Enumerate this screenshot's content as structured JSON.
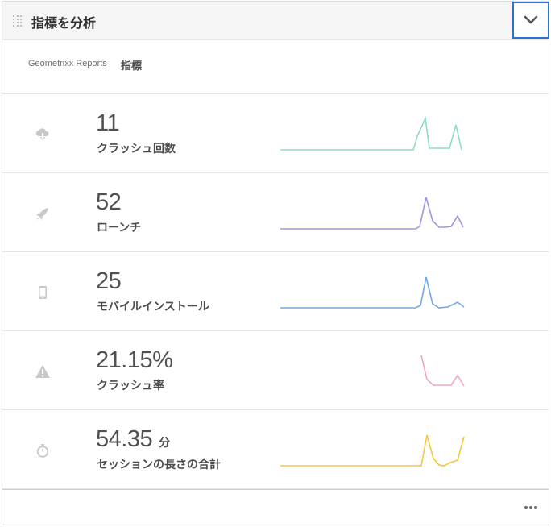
{
  "header": {
    "title": "指標を分析",
    "toggle_icon": "chevron-down-icon"
  },
  "subtitle": {
    "brand": "Geometrixx Reports",
    "label": "指標"
  },
  "colors": {
    "crashes": "#8ddbc9",
    "launches": "#a892e0",
    "installs": "#6ea8ee",
    "crash_rate": "#f1a3c1",
    "session": "#f3c93b",
    "accent": "#2f6fd6"
  },
  "metrics": [
    {
      "value": "11",
      "unit": "",
      "label": "クラッシュ回数",
      "icon": "cloud-download-icon"
    },
    {
      "value": "52",
      "unit": "",
      "label": "ローンチ",
      "icon": "rocket-icon"
    },
    {
      "value": "25",
      "unit": "",
      "label": "モバイルインストール",
      "icon": "mobile-device-icon"
    },
    {
      "value": "21.15%",
      "unit": "",
      "label": "クラッシュ率",
      "icon": "alert-icon"
    },
    {
      "value": "54.35",
      "unit": "分",
      "label": "セッションの長さの合計",
      "icon": "stopwatch-icon"
    }
  ],
  "sparklines": [
    {
      "metric": "crashes",
      "values": [
        0,
        0,
        0,
        0,
        0,
        0,
        0,
        0,
        0,
        0,
        0,
        0,
        0,
        0,
        0,
        0,
        0,
        0,
        0,
        0,
        0,
        0,
        0,
        0,
        0,
        0,
        0,
        0,
        0,
        0,
        0,
        0,
        0,
        0,
        0,
        0,
        0,
        0,
        0,
        0,
        0,
        0,
        0,
        0,
        0,
        0,
        0,
        0,
        0,
        0,
        0,
        0,
        0,
        0,
        0,
        0,
        0,
        0,
        0,
        0,
        0,
        0,
        0,
        0,
        0,
        0,
        0,
        0,
        0,
        0,
        0,
        0,
        0,
        0,
        0,
        0,
        0,
        0,
        0,
        0,
        0,
        0,
        0,
        0,
        0,
        0,
        0,
        0,
        0,
        0,
        0,
        0,
        0,
        0,
        0,
        0,
        0,
        0,
        0,
        0,
        0,
        0,
        0,
        0,
        0,
        0,
        0,
        0,
        0,
        0,
        0,
        0,
        0,
        0,
        0,
        0,
        0,
        0,
        0,
        0,
        0,
        0,
        0,
        0,
        0,
        0,
        0,
        0,
        0,
        0,
        0,
        0,
        0,
        0,
        0,
        0,
        0,
        0,
        0,
        0,
        0,
        0,
        0,
        0,
        0,
        0,
        0,
        0,
        0,
        0,
        0,
        0,
        0,
        0,
        0,
        0,
        0,
        0,
        0,
        0,
        0,
        0,
        0,
        0,
        0,
        0,
        0,
        0,
        0,
        0,
        0,
        0,
        0,
        0,
        0,
        0,
        0,
        0,
        0,
        0,
        0,
        0,
        0,
        0,
        0,
        0,
        0,
        0,
        0,
        0,
        0,
        0,
        0,
        0,
        0,
        0,
        0,
        0,
        0,
        0,
        0,
        0,
        0,
        0,
        0,
        0,
        0,
        0,
        0,
        0,
        0,
        0,
        0,
        0,
        0,
        0,
        0,
        0,
        0,
        0,
        0,
        0,
        0,
        0,
        0,
        0,
        0,
        0,
        0,
        0,
        0,
        0,
        0,
        0,
        0,
        0,
        0,
        0,
        0,
        0,
        0,
        0,
        0,
        0,
        0,
        0,
        0,
        0,
        0,
        0,
        0,
        0,
        0,
        0,
        0,
        0,
        0,
        0
      ]
    },
    {
      "metric": "launches"
    },
    {
      "metric": "installs"
    },
    {
      "metric": "crash_rate"
    },
    {
      "metric": "session"
    }
  ]
}
